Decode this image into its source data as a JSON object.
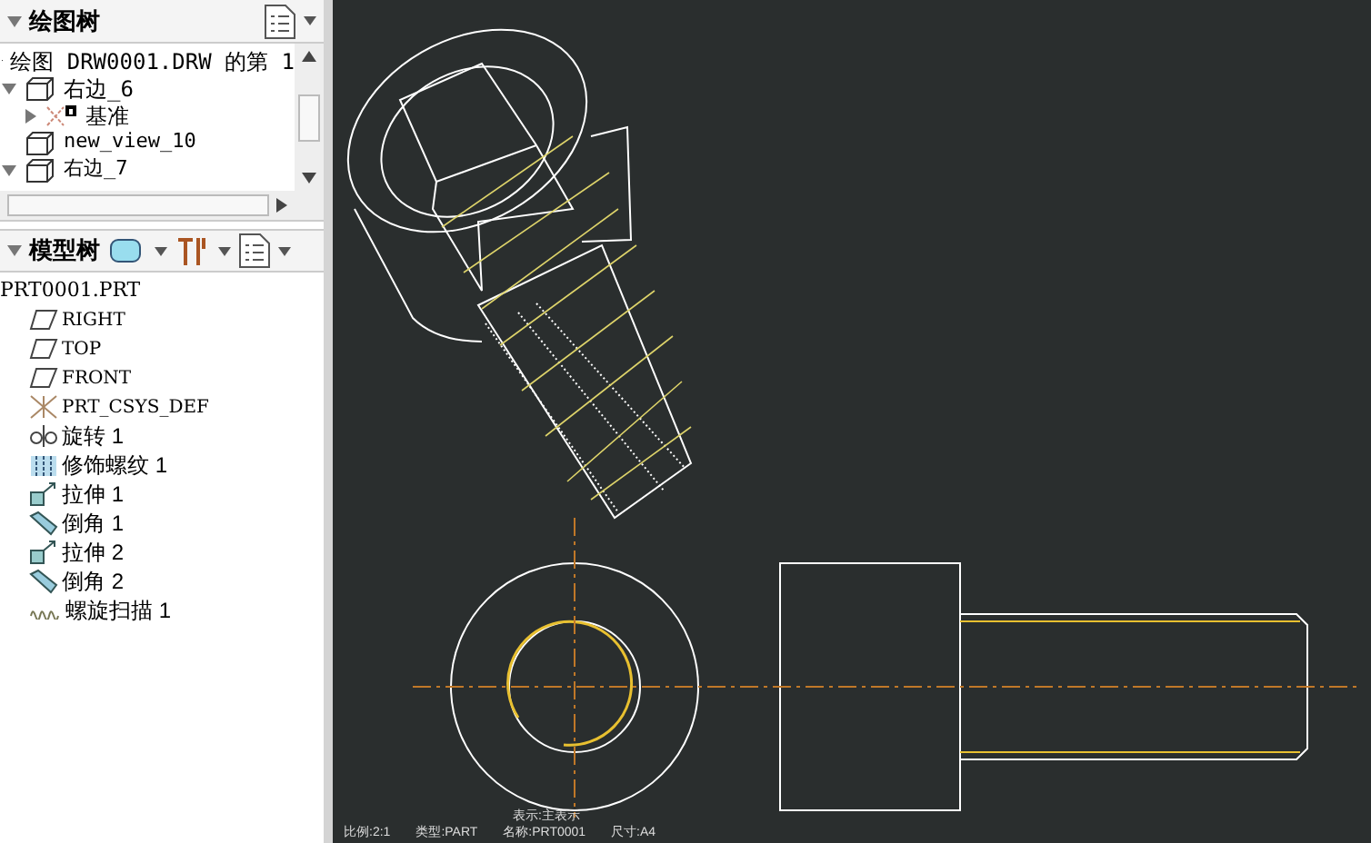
{
  "drawing_tree": {
    "title": "绘图树",
    "items": [
      {
        "label": "绘图 DRW0001.DRW 的第 1",
        "kind": "sheet",
        "children": [
          {
            "label": "右边_6",
            "kind": "view",
            "expanded": true,
            "children": [
              {
                "label": "基准",
                "kind": "datum",
                "expanded": false
              }
            ]
          },
          {
            "label": "new_view_10",
            "kind": "view"
          },
          {
            "label": "右边_7",
            "kind": "view",
            "expanded": true
          }
        ]
      }
    ]
  },
  "model_tree": {
    "title": "模型树",
    "root": "PRT0001.PRT",
    "items": [
      {
        "label": "RIGHT",
        "kind": "plane"
      },
      {
        "label": "TOP",
        "kind": "plane"
      },
      {
        "label": "FRONT",
        "kind": "plane"
      },
      {
        "label": "PRT_CSYS_DEF",
        "kind": "csys"
      },
      {
        "label": "旋转 1",
        "kind": "revolve"
      },
      {
        "label": "修饰螺纹 1",
        "kind": "thread"
      },
      {
        "label": "拉伸 1",
        "kind": "extrude"
      },
      {
        "label": "倒角 1",
        "kind": "chamfer"
      },
      {
        "label": "拉伸 2",
        "kind": "extrude"
      },
      {
        "label": "倒角 2",
        "kind": "chamfer"
      },
      {
        "label": "螺旋扫描 1",
        "kind": "helix"
      }
    ]
  },
  "canvas": {
    "view_label": "表示:主表示",
    "status": [
      "比例:2:1",
      "类型:PART",
      "名称:PRT0001",
      "尺寸:A4"
    ]
  }
}
